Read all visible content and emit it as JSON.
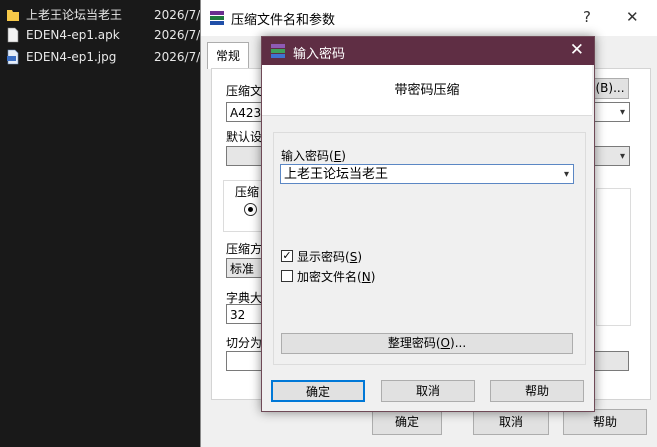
{
  "explorer": {
    "files": [
      {
        "name": "上老王论坛当老王",
        "date": "2026/7/",
        "icon": "folder-icon"
      },
      {
        "name": "EDEN4-ep1.apk",
        "date": "2026/7/",
        "icon": "file-icon"
      },
      {
        "name": "EDEN4-ep1.jpg",
        "date": "2026/7/",
        "icon": "image-file-icon"
      }
    ]
  },
  "back_dialog": {
    "title": "压缩文件名和参数",
    "help_glyph": "?",
    "close_glyph": "✕",
    "tab_general": "常规",
    "archive_name_label": "压缩文",
    "archive_name_value": "A4234",
    "browse_button": "(B)...",
    "default_label": "默认设",
    "format_label": "压缩",
    "method_label": "压缩方",
    "method_value": "标准",
    "dict_label": "字典大",
    "dict_value": "32",
    "split_label": "切分为",
    "ok_button": "确定",
    "cancel_button": "取消",
    "help_button": "帮助"
  },
  "front_dialog": {
    "title": "输入密码",
    "close_glyph": "✕",
    "header": "带密码压缩",
    "password_label": "输入密码",
    "password_hotkey": "E",
    "password_value": "上老王论坛当老王",
    "show_password_label": "显示密码",
    "show_password_hotkey": "S",
    "show_password_checked": true,
    "encrypt_names_label": "加密文件名",
    "encrypt_names_hotkey": "N",
    "encrypt_names_checked": false,
    "organize_button": "整理密码",
    "organize_hotkey": "O",
    "organize_suffix": "...",
    "ok_button": "确定",
    "cancel_button": "取消",
    "help_button": "帮助"
  },
  "colors": {
    "title_accent": "#5f2e44",
    "explorer_bg": "#191919",
    "dialog_bg": "#f0f0f0"
  }
}
